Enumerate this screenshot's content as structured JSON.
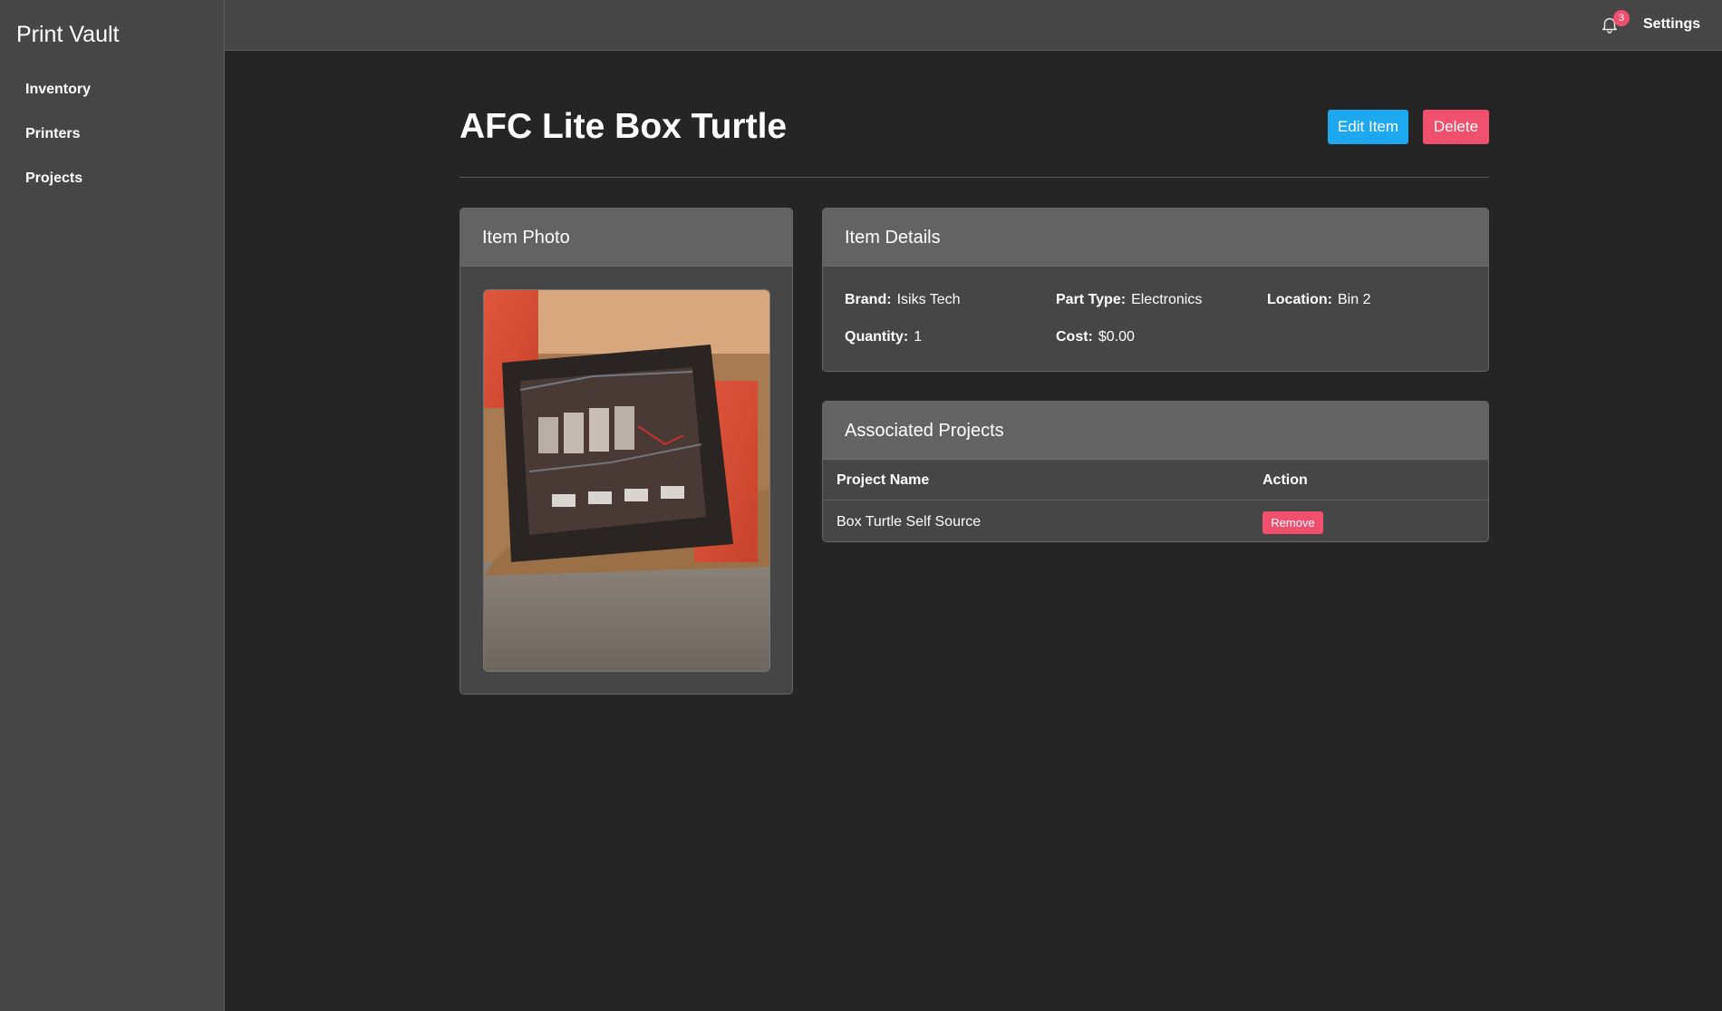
{
  "app": {
    "brand": "Print Vault"
  },
  "sidebar": {
    "items": [
      {
        "label": "Inventory"
      },
      {
        "label": "Printers"
      },
      {
        "label": "Projects"
      }
    ]
  },
  "topbar": {
    "notification_count": "3",
    "settings_label": "Settings",
    "bell_icon": "bell-icon"
  },
  "item": {
    "title": "AFC Lite Box Turtle",
    "edit_label": "Edit Item",
    "delete_label": "Delete"
  },
  "photo_card": {
    "header": "Item Photo"
  },
  "details_card": {
    "header": "Item Details",
    "brand_label": "Brand:",
    "brand_value": "Isiks Tech",
    "part_type_label": "Part Type:",
    "part_type_value": "Electronics",
    "location_label": "Location:",
    "location_value": "Bin 2",
    "quantity_label": "Quantity:",
    "quantity_value": "1",
    "cost_label": "Cost:",
    "cost_value": "$0.00"
  },
  "projects_card": {
    "header": "Associated Projects",
    "columns": [
      "Project Name",
      "Action"
    ],
    "rows": [
      {
        "name": "Box Turtle Self Source",
        "action_label": "Remove"
      }
    ]
  },
  "colors": {
    "accent_blue": "#1da8f0",
    "danger_red": "#f0506e",
    "background": "#252525",
    "panel": "#464646"
  }
}
